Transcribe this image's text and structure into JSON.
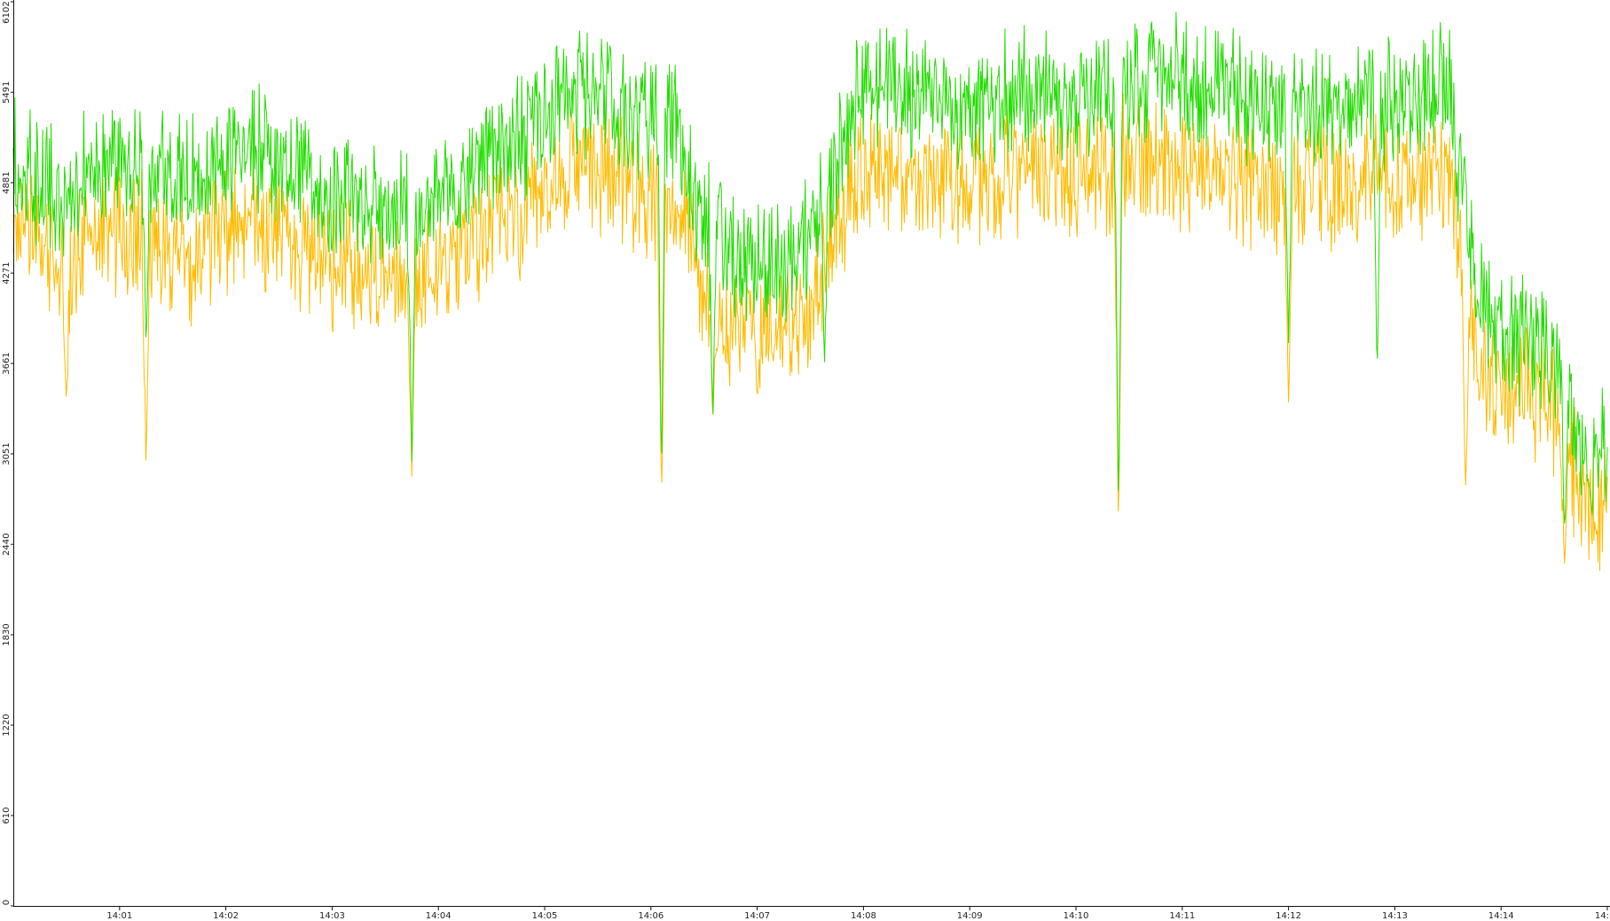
{
  "chart_data": {
    "type": "line",
    "title": "",
    "xlabel": "",
    "ylabel": "",
    "grid": false,
    "legend": "none",
    "x_range": [
      "14:00:00",
      "14:15:00"
    ],
    "ylim": [
      0,
      6102
    ],
    "y_ticks": [
      0,
      610,
      1220,
      1830,
      2440,
      3051,
      3661,
      4271,
      4881,
      5491,
      6102
    ],
    "x_ticks": [
      "14:01",
      "14:02",
      "14:03",
      "14:04",
      "14:05",
      "14:06",
      "14:07",
      "14:08",
      "14:09",
      "14:10",
      "14:11",
      "14:12",
      "14:13",
      "14:14",
      "14:15"
    ],
    "x_tick_labels": [
      "14:01",
      "14:02",
      "14:03",
      "14:04",
      "14:05",
      "14:06",
      "14:07",
      "14:08",
      "14:09",
      "14:10",
      "14:11",
      "14:12",
      "14:13",
      "14:14",
      "14:"
    ],
    "x": [
      "14:00:00",
      "14:00:15",
      "14:00:30",
      "14:00:45",
      "14:01:00",
      "14:01:15",
      "14:01:30",
      "14:01:45",
      "14:02:00",
      "14:02:15",
      "14:02:30",
      "14:02:45",
      "14:03:00",
      "14:03:15",
      "14:03:30",
      "14:03:45",
      "14:04:00",
      "14:04:15",
      "14:04:30",
      "14:04:45",
      "14:05:00",
      "14:05:15",
      "14:05:30",
      "14:05:45",
      "14:06:00",
      "14:06:15",
      "14:06:30",
      "14:06:45",
      "14:07:00",
      "14:07:15",
      "14:07:30",
      "14:07:45",
      "14:08:00",
      "14:08:15",
      "14:08:30",
      "14:08:45",
      "14:09:00",
      "14:09:15",
      "14:09:30",
      "14:09:45",
      "14:10:00",
      "14:10:15",
      "14:10:30",
      "14:10:45",
      "14:11:00",
      "14:11:15",
      "14:11:30",
      "14:11:45",
      "14:12:00",
      "14:12:15",
      "14:12:30",
      "14:12:45",
      "14:13:00",
      "14:13:15",
      "14:13:30",
      "14:13:45",
      "14:14:00",
      "14:14:15",
      "14:14:30",
      "14:14:45",
      "14:15:00"
    ],
    "series": [
      {
        "color": "#22dd00",
        "values": [
          5000,
          4900,
          4800,
          4950,
          5050,
          5000,
          4950,
          4900,
          5050,
          5150,
          5000,
          4900,
          4800,
          4750,
          4700,
          4650,
          4750,
          4900,
          5050,
          5200,
          5350,
          5450,
          5550,
          5400,
          5300,
          5250,
          4600,
          4400,
          4350,
          4300,
          4500,
          5000,
          5550,
          5500,
          5450,
          5350,
          5350,
          5400,
          5500,
          5450,
          5400,
          5450,
          5550,
          5600,
          5550,
          5500,
          5450,
          5400,
          5350,
          5400,
          5450,
          5500,
          5400,
          5450,
          5550,
          4200,
          3900,
          3850,
          3700,
          3100,
          3000
        ],
        "dips": [
          {
            "x": "14:01:15",
            "value": 3750
          },
          {
            "x": "14:03:45",
            "value": 3000
          },
          {
            "x": "14:06:06",
            "value": 2900
          },
          {
            "x": "14:06:35",
            "value": 3300
          },
          {
            "x": "14:07:38",
            "value": 3650
          },
          {
            "x": "14:10:24",
            "value": 2600
          },
          {
            "x": "14:12:00",
            "value": 3800
          },
          {
            "x": "14:12:50",
            "value": 3500
          },
          {
            "x": "14:14:36",
            "value": 2500
          }
        ]
      },
      {
        "color": "#ffbb00",
        "values": [
          4600,
          4450,
          4350,
          4500,
          4600,
          4500,
          4400,
          4350,
          4500,
          4650,
          4550,
          4450,
          4350,
          4300,
          4250,
          4200,
          4300,
          4450,
          4600,
          4700,
          4850,
          4950,
          5000,
          4900,
          4800,
          4750,
          4150,
          3950,
          3950,
          3900,
          4050,
          4550,
          5000,
          4950,
          4900,
          4850,
          4850,
          4900,
          5000,
          4950,
          4900,
          4950,
          5000,
          5050,
          5000,
          4950,
          4900,
          4850,
          4800,
          4850,
          4900,
          4950,
          4850,
          4900,
          5000,
          3800,
          3500,
          3450,
          3350,
          2800,
          2700
        ],
        "dips": [
          {
            "x": "14:00:30",
            "value": 3350
          },
          {
            "x": "14:01:15",
            "value": 2900
          },
          {
            "x": "14:03:45",
            "value": 2900
          },
          {
            "x": "14:06:06",
            "value": 2700
          },
          {
            "x": "14:06:35",
            "value": 3300
          },
          {
            "x": "14:07:00",
            "value": 3400
          },
          {
            "x": "14:10:24",
            "value": 2500
          },
          {
            "x": "14:12:00",
            "value": 3400
          },
          {
            "x": "14:13:40",
            "value": 2800
          },
          {
            "x": "14:14:36",
            "value": 2250
          }
        ]
      }
    ]
  }
}
